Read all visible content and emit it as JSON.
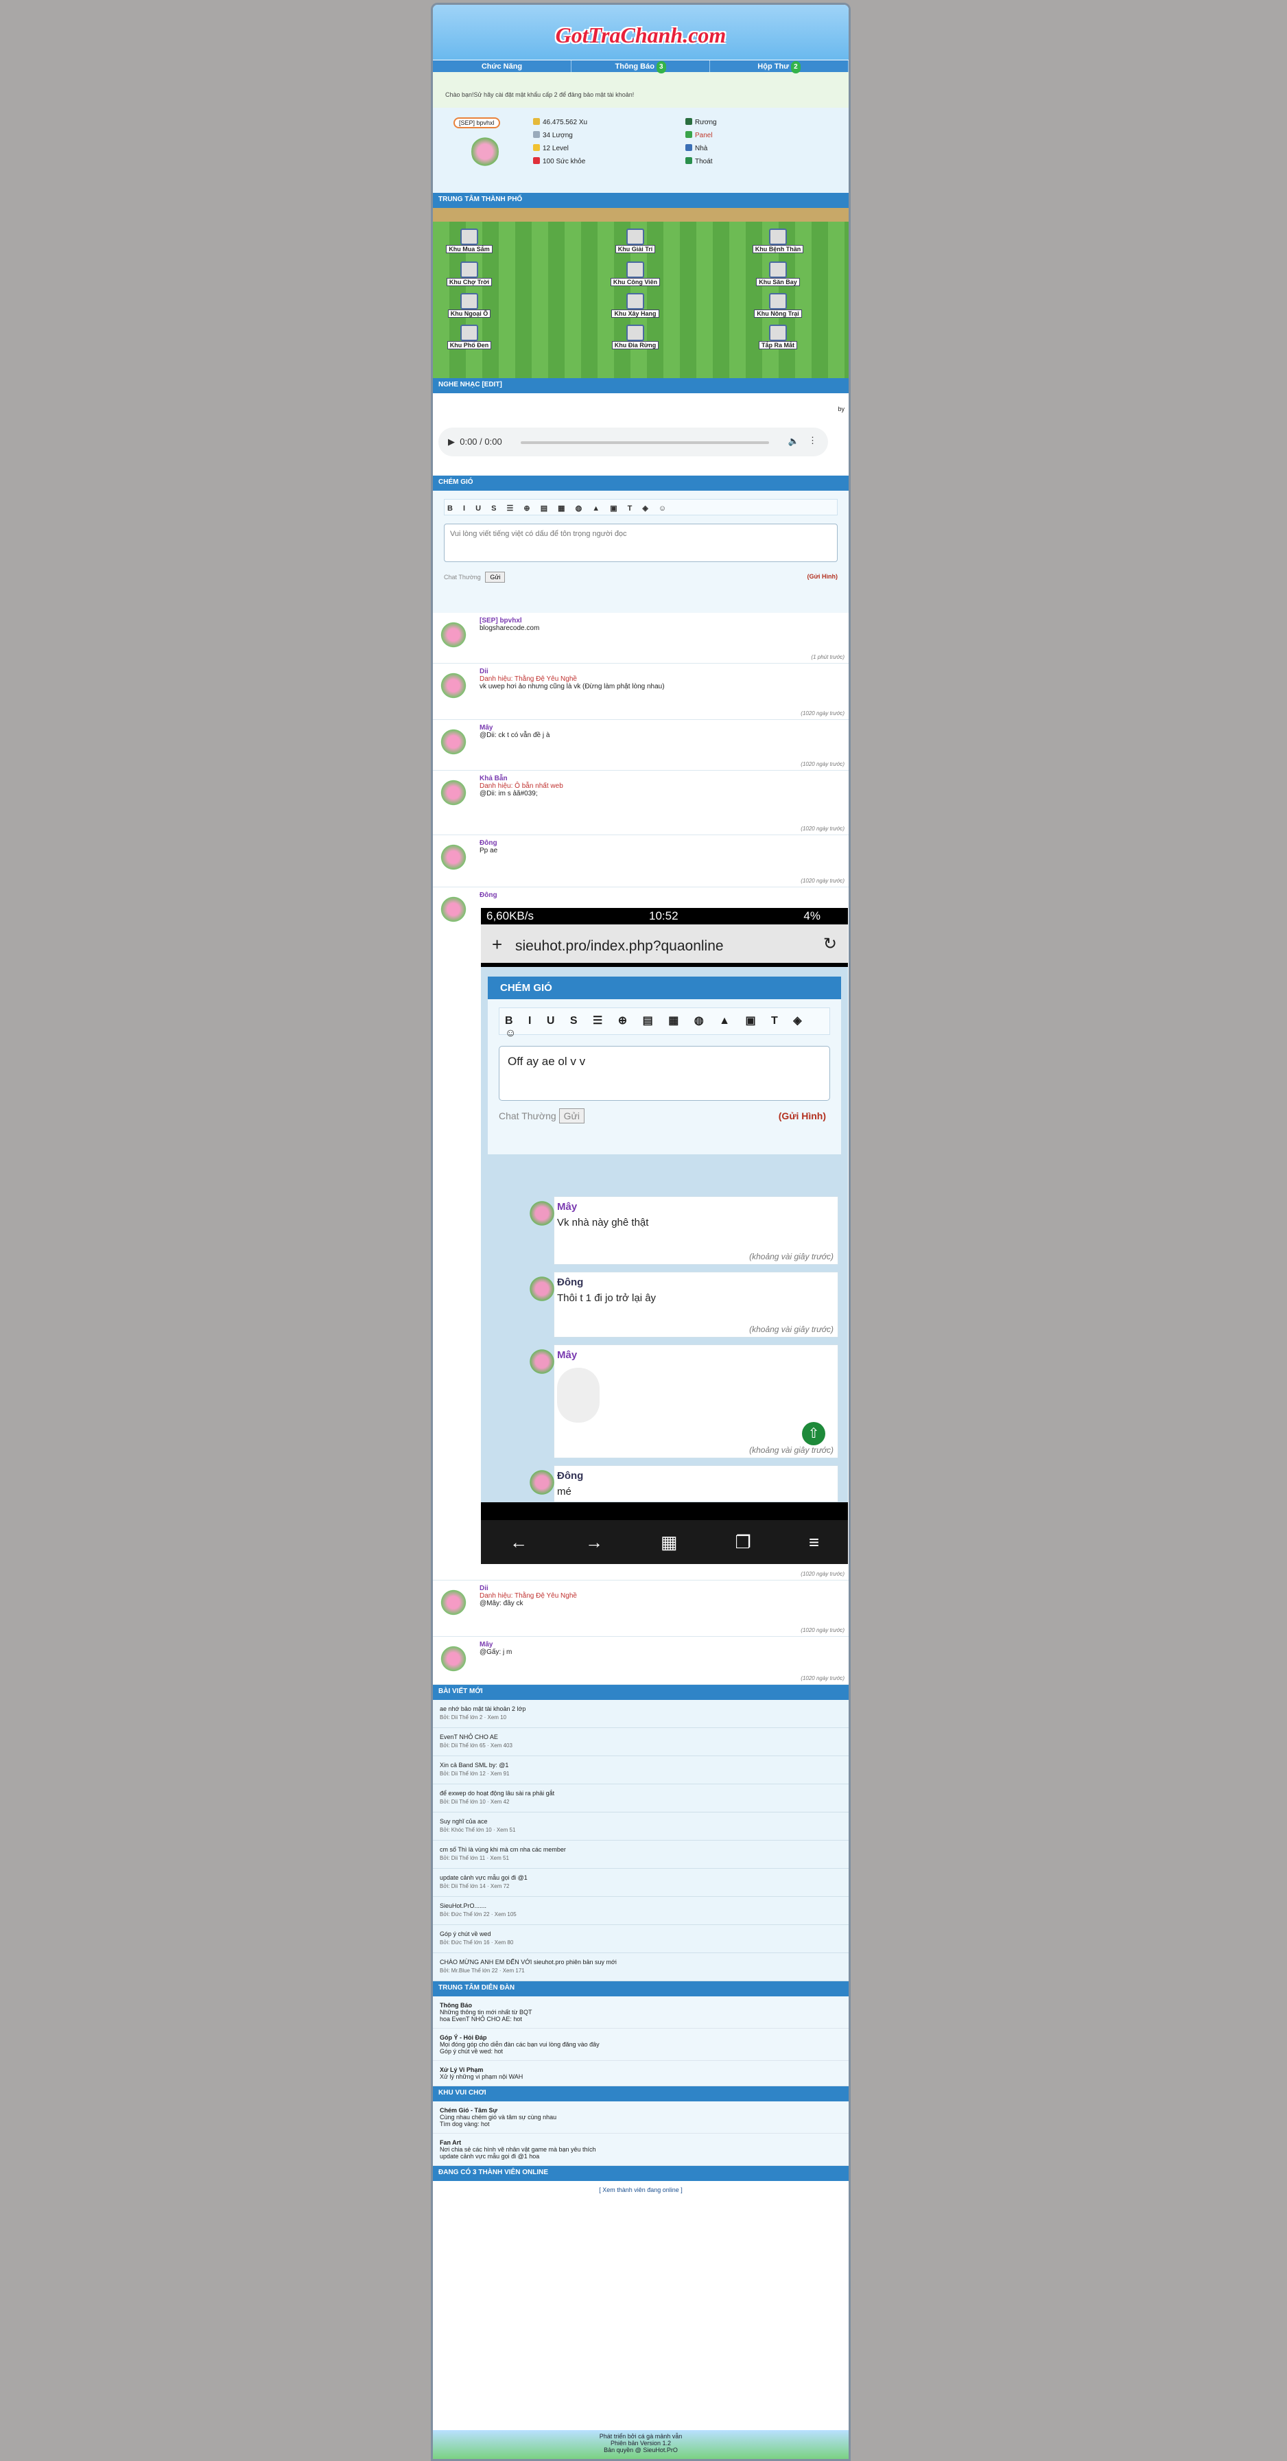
{
  "site": {
    "logo": "GotTraChanh.com"
  },
  "nav": [
    {
      "label": "Chức Năng",
      "count": ""
    },
    {
      "label": "Thông Báo",
      "count": "3"
    },
    {
      "label": "Hộp Thư",
      "count": "2"
    }
  ],
  "notice": "Chào bạn!Sử hãy cài đặt mật khẩu cấp 2 để đảng bảo mật tài khoản!",
  "profile": {
    "tag": "[SEP] bpvhxl",
    "stats": [
      "46.475.562 Xu",
      "34 Lượng",
      "12 Level",
      "100 Sức khỏe"
    ],
    "links": [
      "Rương",
      "Panel",
      "Nhà",
      "Thoát"
    ]
  },
  "city": {
    "title": "TRUNG TÂM THÀNH PHỐ",
    "buildings": [
      "Khu Mua Sắm",
      "Khu Giải Trí",
      "Khu Bệnh Thần",
      "Khu Chợ Trời",
      "Khu Công Viên",
      "Khu Săn Bay",
      "Khu Ngoại Ô",
      "Khu Xây Hang",
      "Khu Nông Trại",
      "Khu Phố Đen",
      "Khu Đia Rừng",
      "Tắp Ra Mắt"
    ]
  },
  "music": {
    "title": "NGHE NHẠC [EDIT]",
    "time": "0:00 / 0:00",
    "by": "by"
  },
  "chat": {
    "title": "CHÉM GIÓ",
    "placeholder": "Vui lòng viết tiếng việt có dấu để tôn trọng người đọc",
    "mode": "Chat Thường",
    "send": "Gửi",
    "send_image": "(Gửi Hình)",
    "messages": [
      {
        "name": "[SEP] bpvhxl",
        "text": "blogsharecode.com",
        "time": "(1 phút trước)"
      },
      {
        "name": "Dii",
        "title": "Danh hiệu: Thằng Đệ Yêu Nghề",
        "text": "vk uwep hơi ảo nhưng cũng là vk (Đừng làm phật lòng nhau)",
        "time": "(1020 ngày trước)"
      },
      {
        "name": "Mây",
        "text": "@Dii: ck t có vẫn đề j à",
        "time": "(1020 ngày trước)"
      },
      {
        "name": "Khả Bẫn",
        "title": "Danh hiệu: Ô bẫn nhất web",
        "text": "@Dii: im s ảã#039;",
        "time": "(1020 ngày trước)"
      },
      {
        "name": "Đông",
        "text": "Pp ae",
        "time": "(1020 ngày trước)"
      },
      {
        "name": "Đông",
        "text": "",
        "time": "(1020 ngày trước)"
      },
      {
        "name": "Dii",
        "title": "Danh hiệu: Thằng Đệ Yêu Nghề",
        "text": "@Mây: đây ck",
        "time": "(1020 ngày trước)"
      },
      {
        "name": "Mây",
        "text": "@Gấy: j m",
        "time": "(1020 ngày trước)"
      }
    ]
  },
  "phone": {
    "speed": "6,60KB/s",
    "clock": "10:52",
    "battery": "4%",
    "url": "sieuhot.pro/index.php?quaonline",
    "chat_title": "CHÉM GIÓ",
    "input": "Off ay ae ol v v",
    "mode": "Chat Thường",
    "send": "Gửi",
    "send_image": "(Gửi Hình)",
    "messages": [
      {
        "name": "Mây",
        "text": "Vk nhà này ghê thật",
        "time": "(khoảng vài giây trước)"
      },
      {
        "name": "Đông",
        "text": "Thôi t 1 đi jo trở lại ây",
        "time": "(khoảng vài giây trước)"
      },
      {
        "name": "Mây",
        "text": "",
        "time": "(khoảng vài giây trước)"
      },
      {
        "name": "Đông",
        "text": "mé",
        "time": ""
      }
    ]
  },
  "posts": {
    "title": "BÀI VIẾT MỚI",
    "items": [
      {
        "title": "ae nhớ bảo mật tài khoản 2 lớp",
        "meta": "Bởi: Dii Thể lớn 2 · Xem 10"
      },
      {
        "title": "EvenT NHỎ CHO AE",
        "meta": "Bởi: Dii Thể lớn 65 · Xem 403"
      },
      {
        "title": "Xin cả Band SML by: @1",
        "meta": "Bởi: Dii Thể lớn 12 · Xem 91"
      },
      {
        "title": "để exwep do hoạt động lâu sài ra phải gắt",
        "meta": "Bởi: Dii Thể lớn 10 · Xem 42"
      },
      {
        "title": "Suy nghĩ của ace",
        "meta": "Bởi: Khóc Thể lớn 10 · Xem 51"
      },
      {
        "title": "cm số Thì là vùng khi mà cm nha các member",
        "meta": "Bởi: Dii Thể lớn 11 · Xem 51"
      },
      {
        "title": "update cảnh vực mẫu gọi đi @1",
        "meta": "Bởi: Dii Thể lớn 14 · Xem 72"
      },
      {
        "title": "SieuHot.PrO.......",
        "meta": "Bởi: Đức Thể lớn 22 · Xem 105"
      },
      {
        "title": "Góp ý chút về wed",
        "meta": "Bởi: Đức Thể lớn 16 · Xem 80"
      },
      {
        "title": "CHÀO MỪNG ANH EM ĐẾN VỚI sieuhot.pro phiên bản suy mới",
        "meta": "Bởi: Mr.Blue Thể lớn 22 · Xem 171"
      }
    ]
  },
  "center": {
    "title": "TRUNG TÂM DIỄN ĐÀN",
    "rows": [
      {
        "head": "Thông Báo",
        "sub": "Những thông tin mới nhất từ BQT",
        "last": "hoa EvenT NHỎ CHO AE: hot"
      },
      {
        "head": "Góp Ý - Hỏi Đáp",
        "sub": "Mọi đóng góp cho diễn đàn các bạn vui lòng đăng vào đây",
        "last": "Góp ý chút về wed: hot"
      },
      {
        "head": "Xử Lý Vi Phạm",
        "sub": "Xử lý những vi phạm nội WAH",
        "last": ""
      }
    ]
  },
  "fun": {
    "title": "KHU VUI CHƠI",
    "rows": [
      {
        "head": "Chém Gió - Tâm Sự",
        "sub": "Cùng nhau chém gió và tâm sự cùng nhau",
        "last": "Tìm dog vàng: hot"
      },
      {
        "head": "Fan Art",
        "sub": "Nơi chia sẻ các hình vẽ nhân vật game mà bạn yêu thích",
        "last": "update cảnh vực mẫu gọi đi @1 hoa"
      }
    ]
  },
  "online": {
    "title": "ĐANG CÓ 3 THÀNH VIÊN ONLINE",
    "link": "[ Xem thành viên đang online ]"
  },
  "footer": {
    "line1": "Phát triển bởi cá gà mảnh vẫn",
    "line2": "Phiên bản Version 1.2",
    "line3": "Bản quyền @ SieuHot.PrO"
  }
}
